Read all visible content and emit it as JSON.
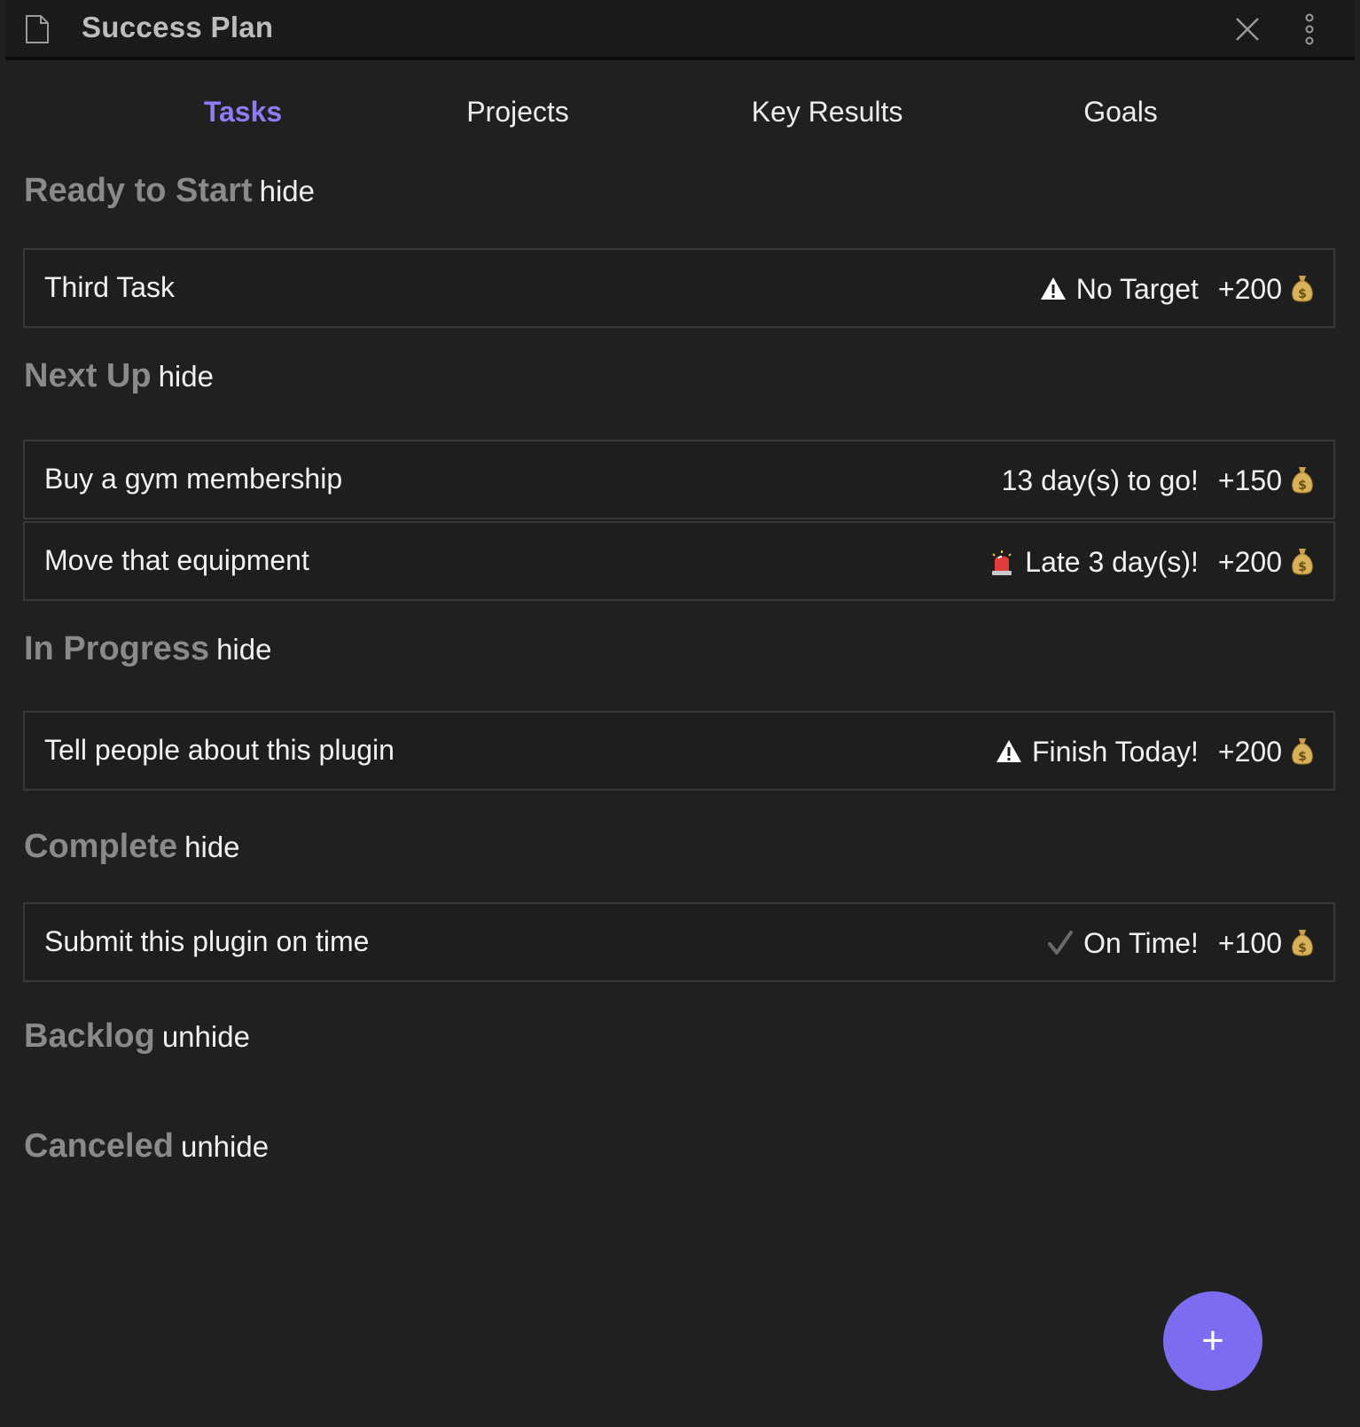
{
  "header": {
    "title": "Success Plan",
    "file_icon": "document-icon",
    "close_icon": "close-icon",
    "more_icon": "more-vertical-icon"
  },
  "tabs": [
    {
      "label": "Tasks",
      "active": true
    },
    {
      "label": "Projects",
      "active": false
    },
    {
      "label": "Key Results",
      "active": false
    },
    {
      "label": "Goals",
      "active": false
    }
  ],
  "sections": {
    "ready_to_start": {
      "title": "Ready to Start",
      "toggle": "hide",
      "tasks": [
        {
          "name": "Third Task",
          "status_icon": "warning-icon",
          "status": "No Target",
          "points": "+200",
          "reward_icon": "money-bag-icon"
        }
      ]
    },
    "next_up": {
      "title": "Next Up",
      "toggle": "hide",
      "tasks": [
        {
          "name": "Buy a gym membership",
          "status_icon": "",
          "status": "13 day(s) to go!",
          "points": "+150",
          "reward_icon": "money-bag-icon"
        },
        {
          "name": "Move that equipment",
          "status_icon": "siren-icon",
          "status": "Late 3 day(s)!",
          "points": "+200",
          "reward_icon": "money-bag-icon"
        }
      ]
    },
    "in_progress": {
      "title": "In Progress",
      "toggle": "hide",
      "tasks": [
        {
          "name": "Tell people about this plugin",
          "status_icon": "warning-icon",
          "status": "Finish Today!",
          "points": "+200",
          "reward_icon": "money-bag-icon"
        }
      ]
    },
    "complete": {
      "title": "Complete",
      "toggle": "hide",
      "tasks": [
        {
          "name": "Submit this plugin on time",
          "status_icon": "checkmark-icon",
          "status": "On Time!",
          "points": "+100",
          "reward_icon": "money-bag-icon"
        }
      ]
    },
    "backlog": {
      "title": "Backlog",
      "toggle": "unhide"
    },
    "canceled": {
      "title": "Canceled",
      "toggle": "unhide"
    }
  },
  "fab": {
    "label": "+",
    "icon": "plus-icon"
  },
  "colors": {
    "accent": "#7b6cf0",
    "active_tab": "#8d7cf2",
    "background": "#202020",
    "header_background": "#1a1a1a",
    "section_title": "#8a8a8a",
    "card_border": "#383838"
  }
}
